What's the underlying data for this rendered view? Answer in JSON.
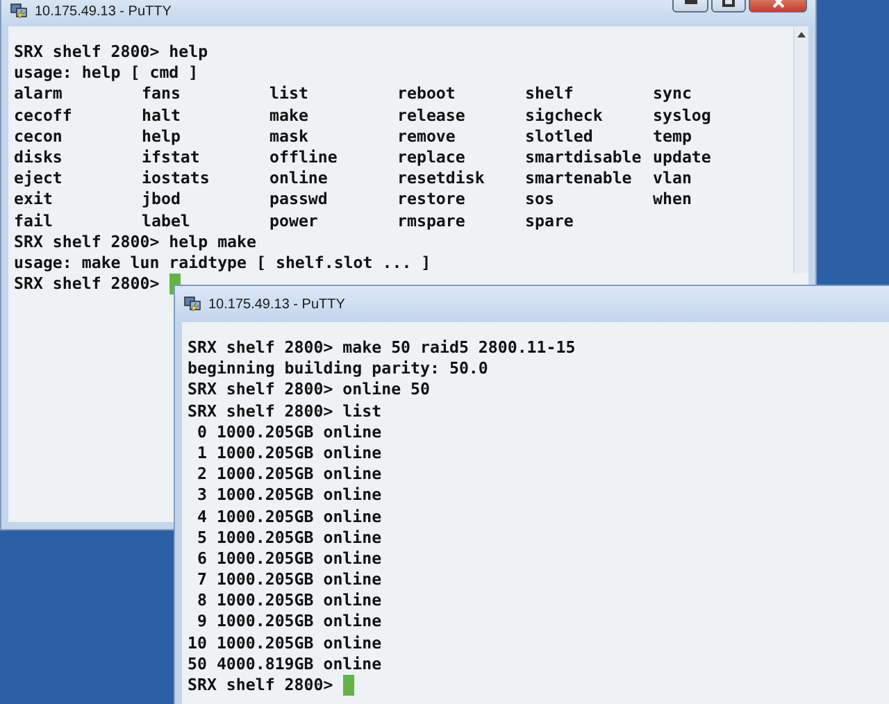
{
  "back_window": {
    "title": "10.175.49.13 - PuTTY",
    "lines": [
      {
        "kind": "text",
        "text": "SRX shelf 2800> help"
      },
      {
        "kind": "text",
        "text": "usage: help [ cmd ]"
      },
      {
        "kind": "columns",
        "cells": [
          "alarm",
          "fans",
          "list",
          "reboot",
          "shelf",
          "sync"
        ]
      },
      {
        "kind": "columns",
        "cells": [
          "cecoff",
          "halt",
          "make",
          "release",
          "sigcheck",
          "syslog"
        ]
      },
      {
        "kind": "columns",
        "cells": [
          "cecon",
          "help",
          "mask",
          "remove",
          "slotled",
          "temp"
        ]
      },
      {
        "kind": "columns",
        "cells": [
          "disks",
          "ifstat",
          "offline",
          "replace",
          "smartdisable",
          "update"
        ]
      },
      {
        "kind": "columns",
        "cells": [
          "eject",
          "iostats",
          "online",
          "resetdisk",
          "smartenable",
          "vlan"
        ]
      },
      {
        "kind": "columns",
        "cells": [
          "exit",
          "jbod",
          "passwd",
          "restore",
          "sos",
          "when"
        ]
      },
      {
        "kind": "columns",
        "cells": [
          "fail",
          "label",
          "power",
          "rmspare",
          "spare"
        ]
      },
      {
        "kind": "text",
        "text": "SRX shelf 2800> help make"
      },
      {
        "kind": "text",
        "text": "usage: make lun raidtype [ shelf.slot ... ]"
      },
      {
        "kind": "prompt",
        "text": "SRX shelf 2800>"
      }
    ]
  },
  "front_window": {
    "title": "10.175.49.13 - PuTTY",
    "lines": [
      {
        "kind": "text",
        "text": "SRX shelf 2800> make 50 raid5 2800.11-15"
      },
      {
        "kind": "text",
        "text": "beginning building parity: 50.0"
      },
      {
        "kind": "text",
        "text": "SRX shelf 2800> online 50"
      },
      {
        "kind": "text",
        "text": "SRX shelf 2800> list"
      },
      {
        "kind": "text",
        "text": " 0 1000.205GB online"
      },
      {
        "kind": "text",
        "text": " 1 1000.205GB online"
      },
      {
        "kind": "text",
        "text": " 2 1000.205GB online"
      },
      {
        "kind": "text",
        "text": " 3 1000.205GB online"
      },
      {
        "kind": "text",
        "text": " 4 1000.205GB online"
      },
      {
        "kind": "text",
        "text": " 5 1000.205GB online"
      },
      {
        "kind": "text",
        "text": " 6 1000.205GB online"
      },
      {
        "kind": "text",
        "text": " 7 1000.205GB online"
      },
      {
        "kind": "text",
        "text": " 8 1000.205GB online"
      },
      {
        "kind": "text",
        "text": " 9 1000.205GB online"
      },
      {
        "kind": "text",
        "text": "10 1000.205GB online"
      },
      {
        "kind": "text",
        "text": "50 4000.819GB online"
      },
      {
        "kind": "prompt",
        "text": "SRX shelf 2800>"
      }
    ]
  }
}
